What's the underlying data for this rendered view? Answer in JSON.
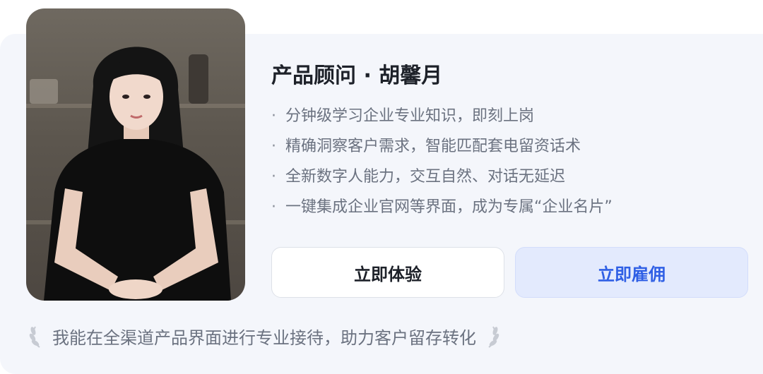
{
  "advisor": {
    "title": "产品顾问 · 胡馨月",
    "features": [
      "分钟级学习企业专业知识，即刻上岗",
      "精确洞察客户需求，智能匹配套电留资话术",
      "全新数字人能力，交互自然、对话无延迟",
      "一键集成企业官网等界面，成为专属“企业名片”"
    ],
    "bullet": "·"
  },
  "buttons": {
    "trial_label": "立即体验",
    "hire_label": "立即雇佣"
  },
  "slogan": {
    "text": "我能在全渠道产品界面进行专业接待，助力客户留存转化"
  },
  "colors": {
    "card_background": "#f4f6fb",
    "accent_blue": "#2f5fe5",
    "hire_button_bg": "#e3eafd",
    "text_primary": "#1d2129",
    "text_secondary": "#6b7280"
  },
  "icons": {
    "laurel_left": "laurel-left-icon",
    "laurel_right": "laurel-right-icon"
  }
}
